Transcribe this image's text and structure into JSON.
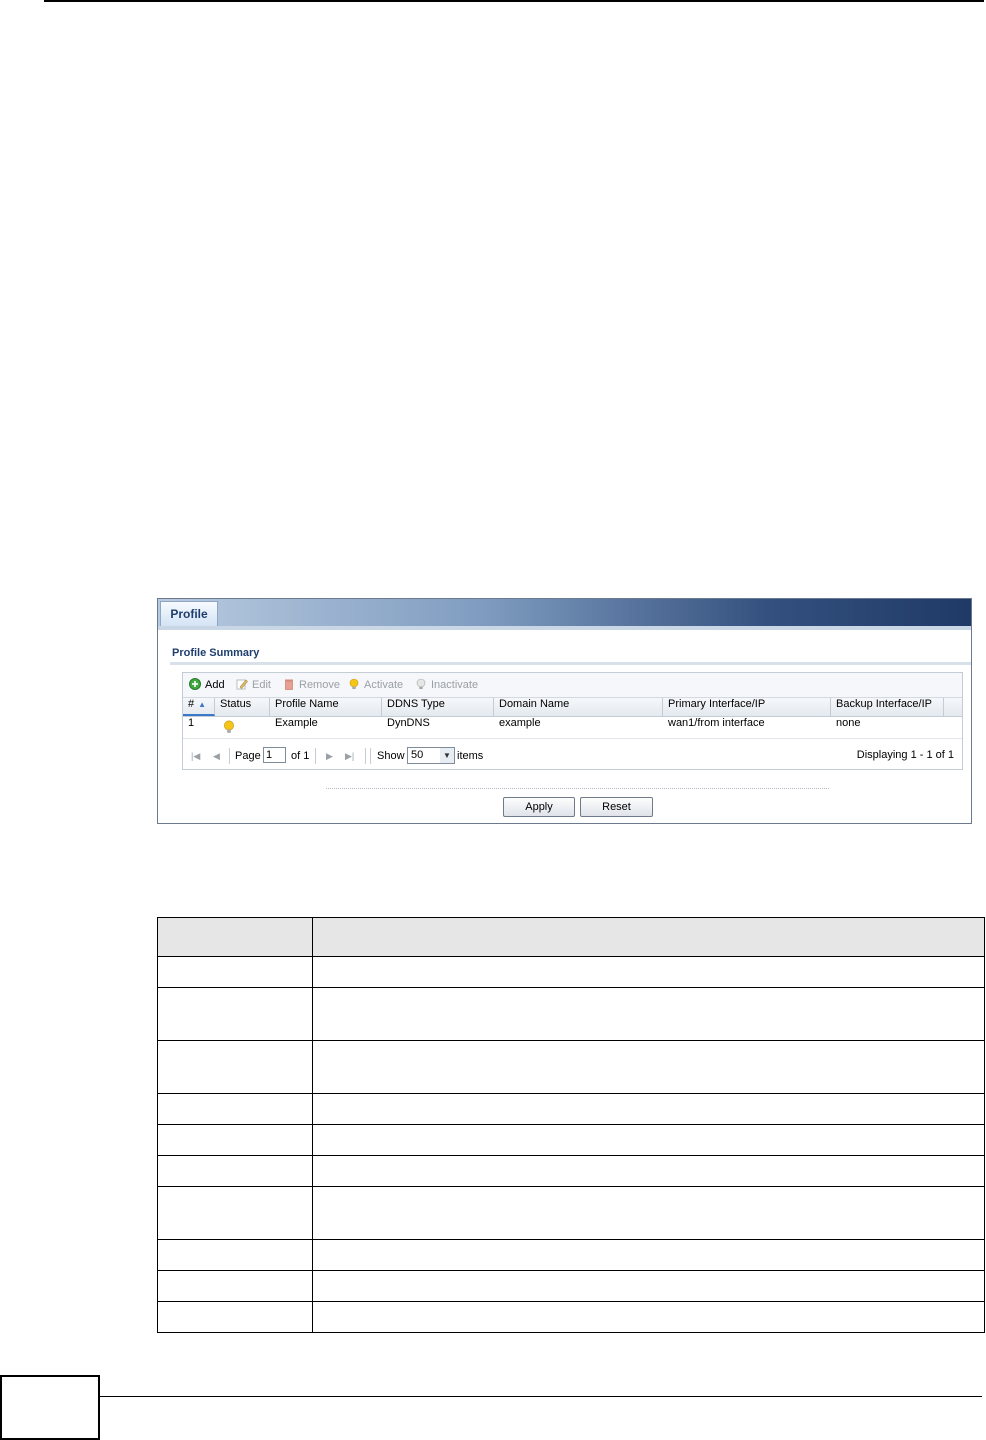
{
  "panel": {
    "tab_label": "Profile",
    "section_title": "Profile Summary",
    "toolbar": {
      "add": "Add",
      "edit": "Edit",
      "remove": "Remove",
      "activate": "Activate",
      "inactivate": "Inactivate"
    },
    "columns": [
      "#",
      "Status",
      "Profile Name",
      "DDNS Type",
      "Domain Name",
      "Primary Interface/IP",
      "Backup Interface/IP"
    ],
    "rows": [
      {
        "num": "1",
        "status_icon": "bulb-on-icon",
        "profile_name": "Example",
        "ddns_type": "DynDNS",
        "domain_name": "example",
        "primary": "wan1/from interface",
        "backup": "none"
      }
    ],
    "pager": {
      "page_label": "Page",
      "page_value": "1",
      "of_label": "of 1",
      "show_label": "Show",
      "show_value": "50",
      "items_label": "items",
      "displaying": "Displaying 1 - 1 of 1"
    },
    "apply_label": "Apply",
    "reset_label": "Reset"
  },
  "colors": {
    "header_dark": "#1f3a66",
    "title_blue": "#1e3e6e",
    "sort_blue": "#3a78c8",
    "bulb": "#f5c518"
  }
}
